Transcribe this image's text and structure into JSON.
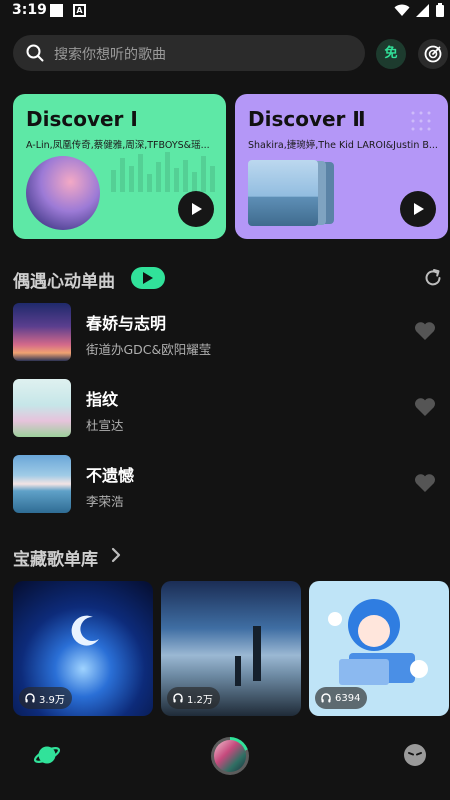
{
  "status_bar": {
    "time": "3:19",
    "icons": [
      "white-square-icon",
      "a-square-icon",
      "wifi-icon",
      "signal-icon",
      "battery-icon"
    ]
  },
  "header": {
    "search_placeholder": "搜索你想听的歌曲",
    "free_badge": "免",
    "icons": [
      "search-icon",
      "radar-icon"
    ]
  },
  "discover_cards": [
    {
      "title": "Discover Ⅰ",
      "subtitle": "A-Lin,凤凰传奇,蔡健雅,周深,TFBOYS&瑶...",
      "color": "#5ee8a6"
    },
    {
      "title": "Discover Ⅱ",
      "subtitle": "Shakira,捷琬婷,The Kid LAROI&Justin B...",
      "color": "#b497f7"
    }
  ],
  "heartbeat_section": {
    "title": "偶遇心动单曲",
    "songs": [
      {
        "title": "春娇与志明",
        "artist": "街道办GDC&欧阳耀莹"
      },
      {
        "title": "指纹",
        "artist": "杜宣达"
      },
      {
        "title": "不遗憾",
        "artist": "李荣浩"
      }
    ]
  },
  "treasure_section": {
    "title": "宝藏歌单库",
    "playlists": [
      {
        "plays": "3.9万"
      },
      {
        "plays": "1.2万"
      },
      {
        "plays": "6394"
      }
    ]
  },
  "bottom_nav": {
    "items": [
      "planet-icon",
      "now-playing-avatar",
      "face-icon"
    ]
  },
  "colors": {
    "accent": "#31e29a",
    "background": "#131313",
    "card_green": "#5ee8a6",
    "card_purple": "#b497f7"
  }
}
